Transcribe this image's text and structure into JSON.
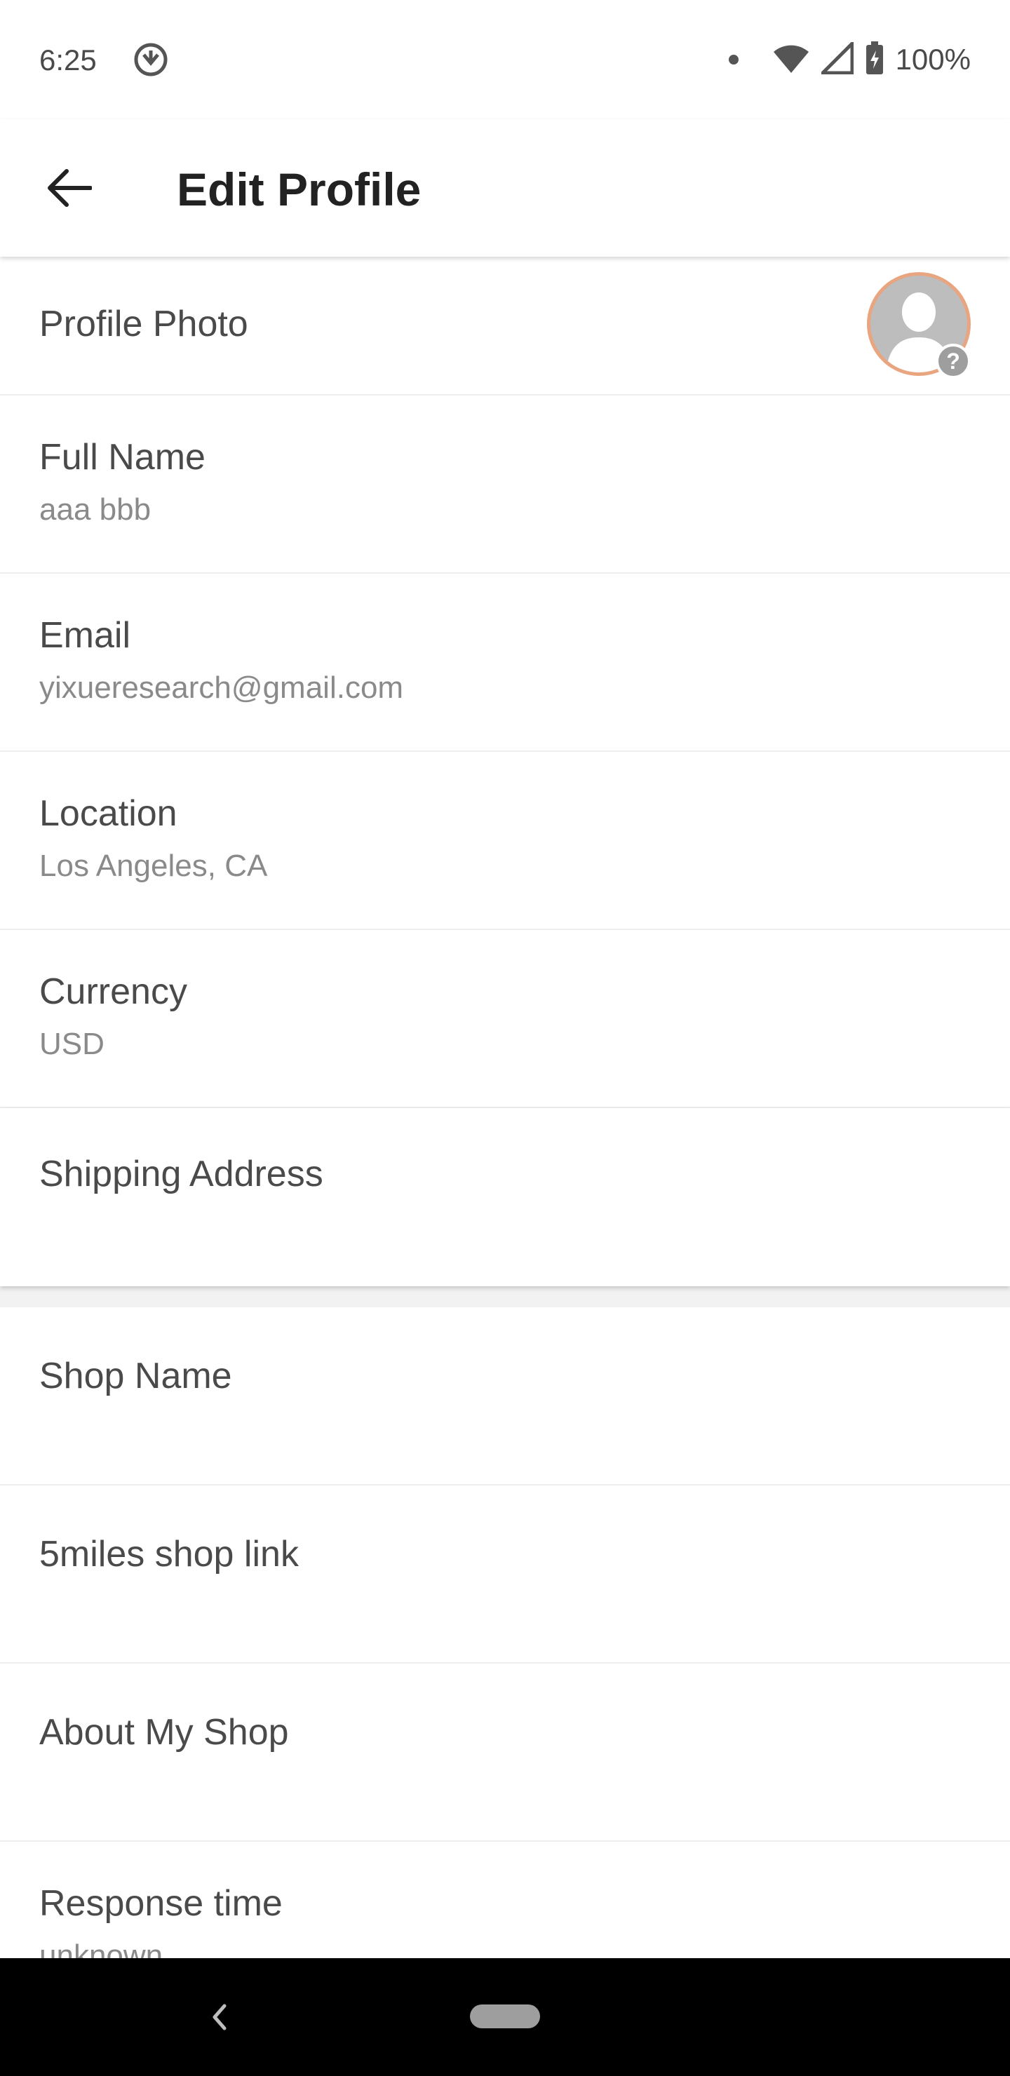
{
  "status_bar": {
    "time": "6:25",
    "battery": "100%"
  },
  "app_bar": {
    "title": "Edit Profile"
  },
  "profile_photo": {
    "label": "Profile Photo",
    "badge": "?"
  },
  "fields": [
    {
      "label": "Full Name",
      "value": "aaa bbb"
    },
    {
      "label": "Email",
      "value": "yixueresearch@gmail.com"
    },
    {
      "label": "Location",
      "value": "Los Angeles, CA"
    },
    {
      "label": "Currency",
      "value": "USD"
    },
    {
      "label": "Shipping Address",
      "value": ""
    }
  ],
  "shop_fields": [
    {
      "label": "Shop Name",
      "value": ""
    },
    {
      "label": "5miles shop link",
      "value": ""
    },
    {
      "label": "About My Shop",
      "value": ""
    },
    {
      "label": "Response time",
      "value": "unknown"
    }
  ],
  "colors": {
    "accent_ring": "#e8a57f",
    "label_text": "#4a4a4a",
    "value_text": "#8a8a8a"
  }
}
